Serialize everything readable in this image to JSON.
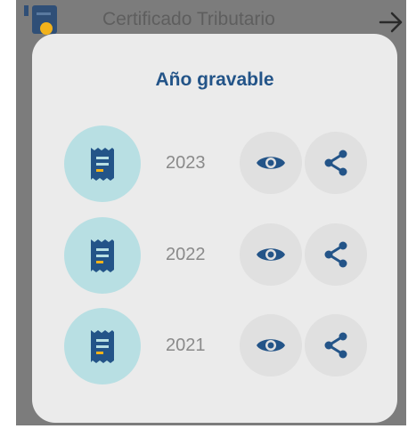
{
  "background_screen": {
    "title": "Certificado Tributario",
    "back_icon": "document-icon",
    "next_icon": "arrow-right-icon"
  },
  "dialog": {
    "title": "Año gravable",
    "items": [
      {
        "year": "2023"
      },
      {
        "year": "2022"
      },
      {
        "year": "2021"
      }
    ],
    "icons": {
      "receipt": "receipt-icon",
      "view": "eye-icon",
      "share": "share-icon"
    }
  },
  "colors": {
    "primary": "#235488",
    "icon_circle": "#b8dfe3",
    "accent": "#f2b21b",
    "dialog_bg": "#ebebeb",
    "action_bg": "#e0e0e0"
  }
}
